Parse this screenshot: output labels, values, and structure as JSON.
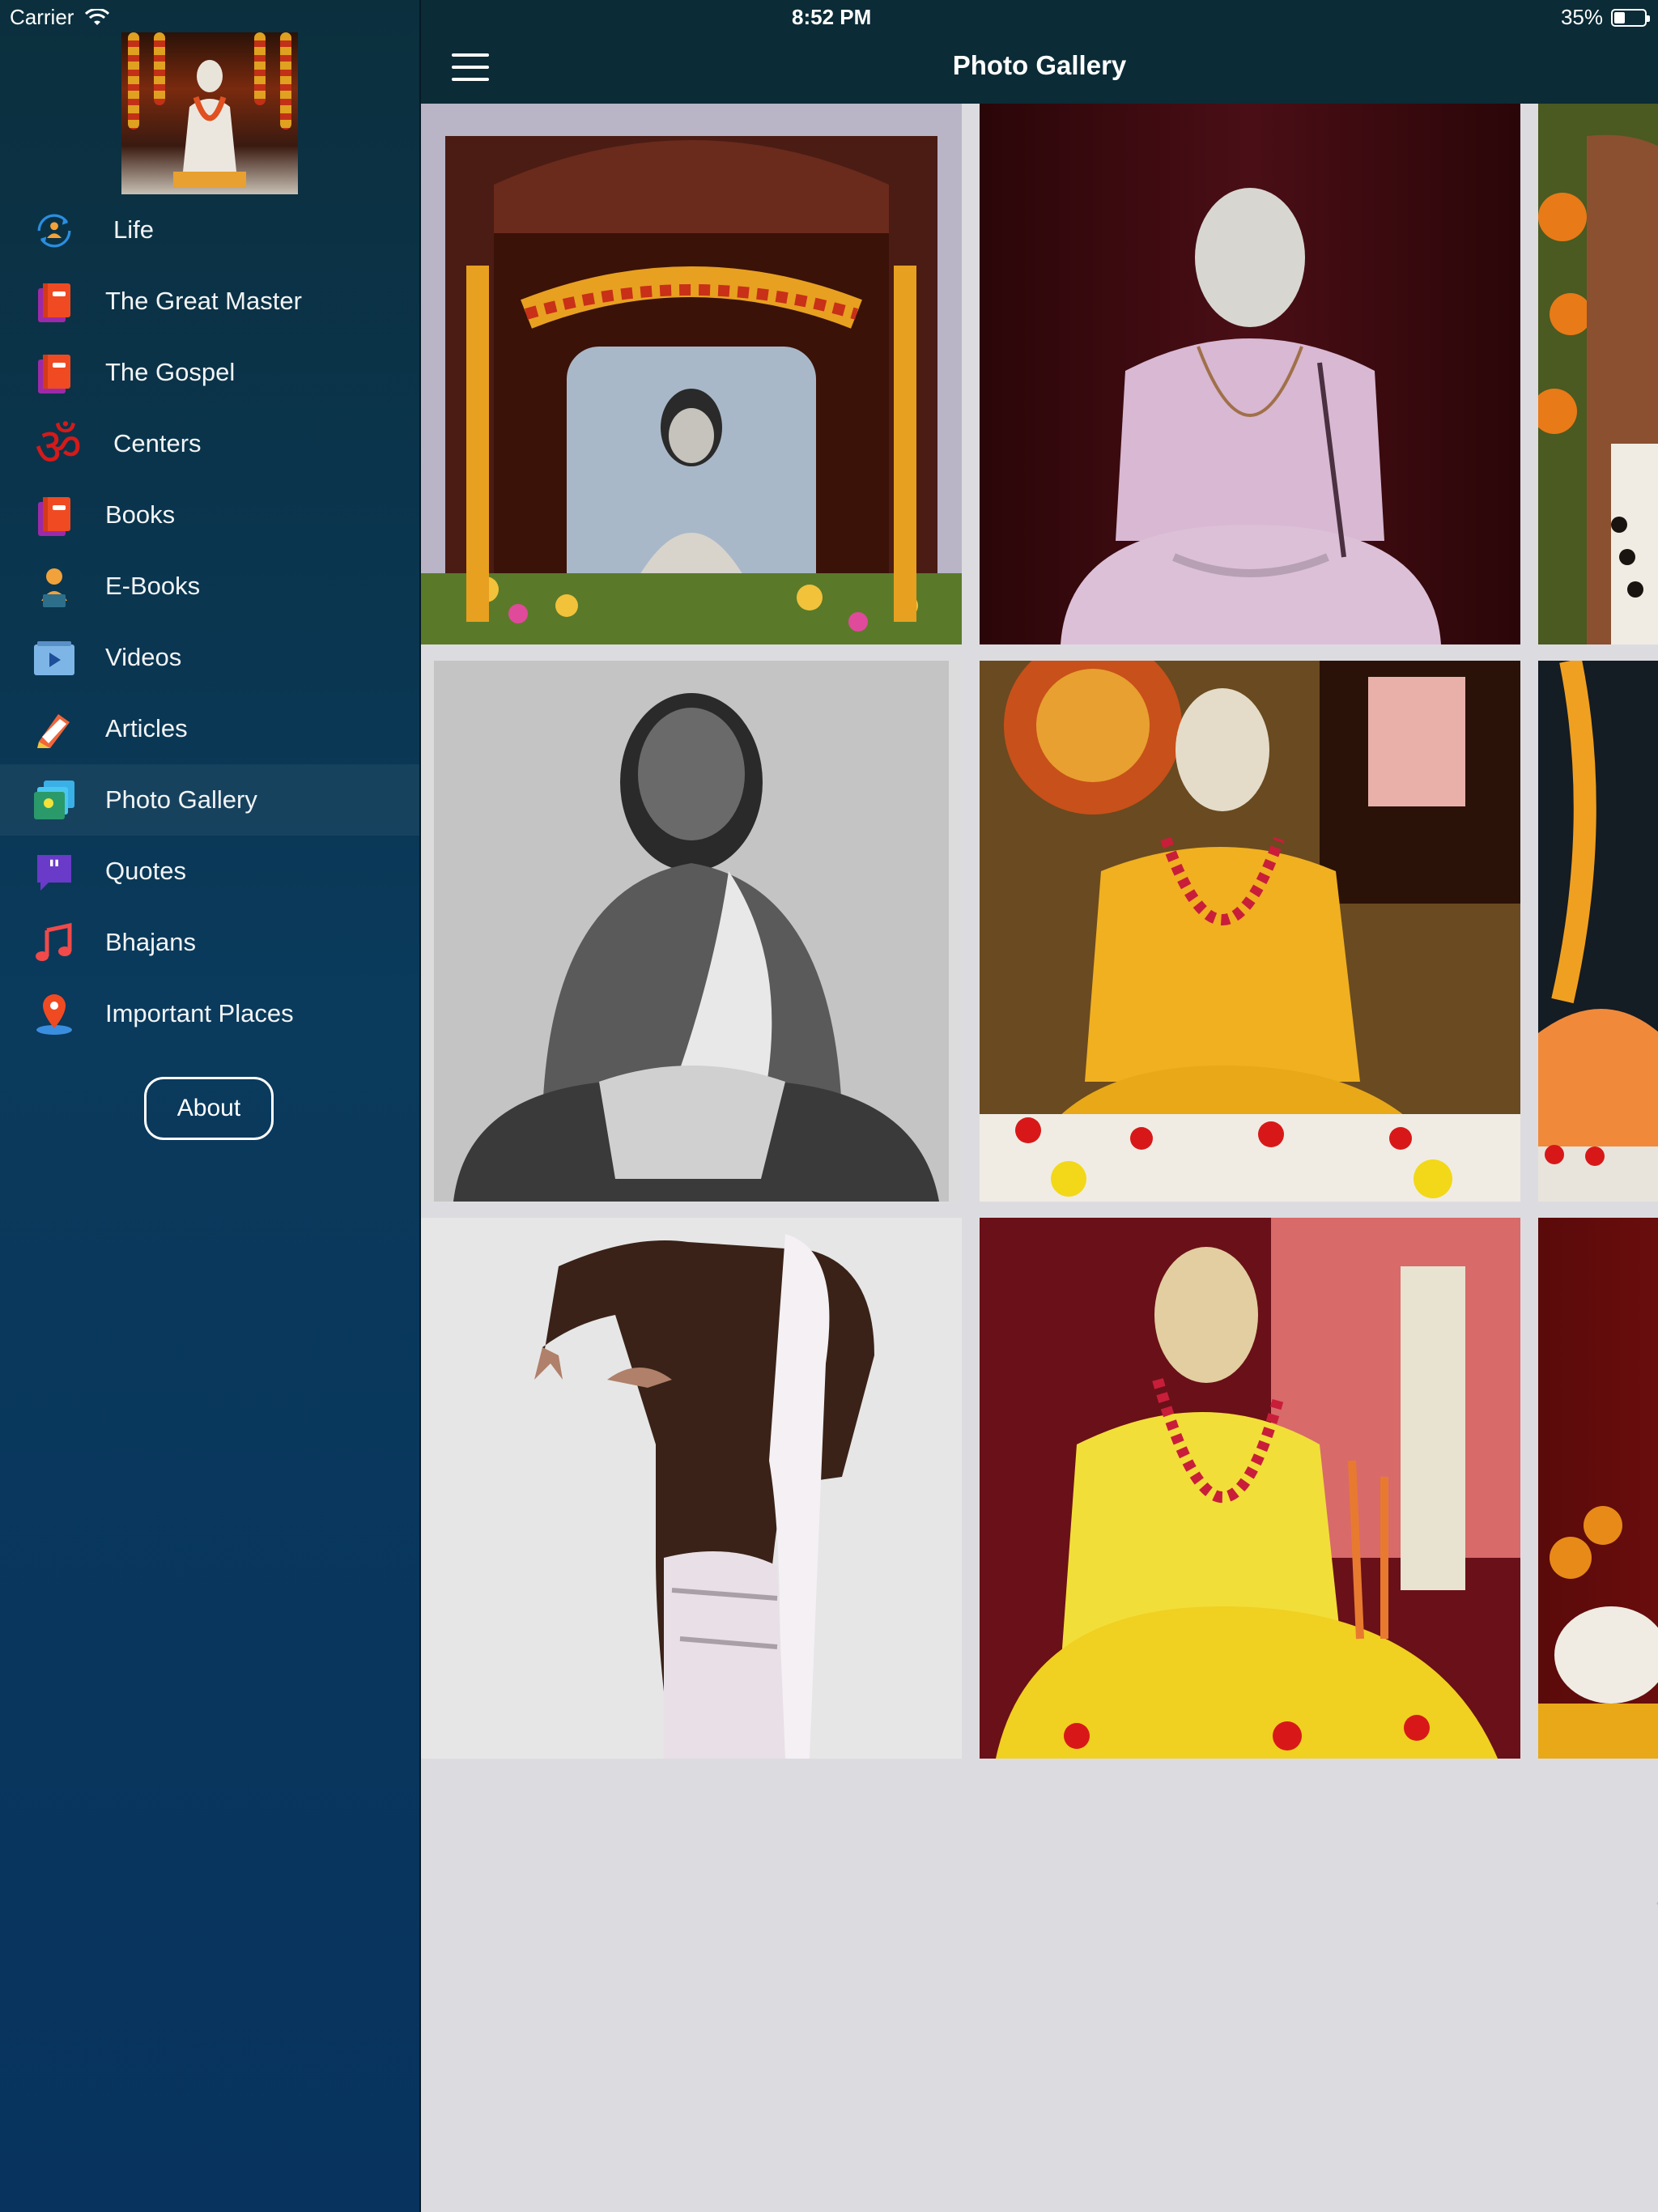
{
  "status_bar": {
    "carrier": "Carrier",
    "time": "8:52 PM",
    "battery": "35%",
    "battery_level": 0.35
  },
  "header": {
    "title": "Photo Gallery",
    "menu_icon": "hamburger-icon"
  },
  "sidebar": {
    "items": [
      {
        "label": "Life",
        "icon": "life-cycle-icon"
      },
      {
        "label": "The Great Master",
        "icon": "book-icon"
      },
      {
        "label": "The Gospel",
        "icon": "book-icon"
      },
      {
        "label": "Centers",
        "icon": "om-icon"
      },
      {
        "label": "Books",
        "icon": "book-icon"
      },
      {
        "label": "E-Books",
        "icon": "reader-icon"
      },
      {
        "label": "Videos",
        "icon": "video-icon"
      },
      {
        "label": "Articles",
        "icon": "articles-icon"
      },
      {
        "label": "Photo Gallery",
        "icon": "photo-gallery-icon",
        "active": true
      },
      {
        "label": "Quotes",
        "icon": "quote-icon"
      },
      {
        "label": "Bhajans",
        "icon": "music-note-icon"
      },
      {
        "label": "Important Places",
        "icon": "location-pin-icon"
      }
    ],
    "about_label": "About"
  },
  "colors": {
    "sidebar_top": "#0b2f3d",
    "sidebar_bottom": "#07335e",
    "header_bg": "#0b2b36",
    "gallery_bg": "#dcdce0"
  }
}
